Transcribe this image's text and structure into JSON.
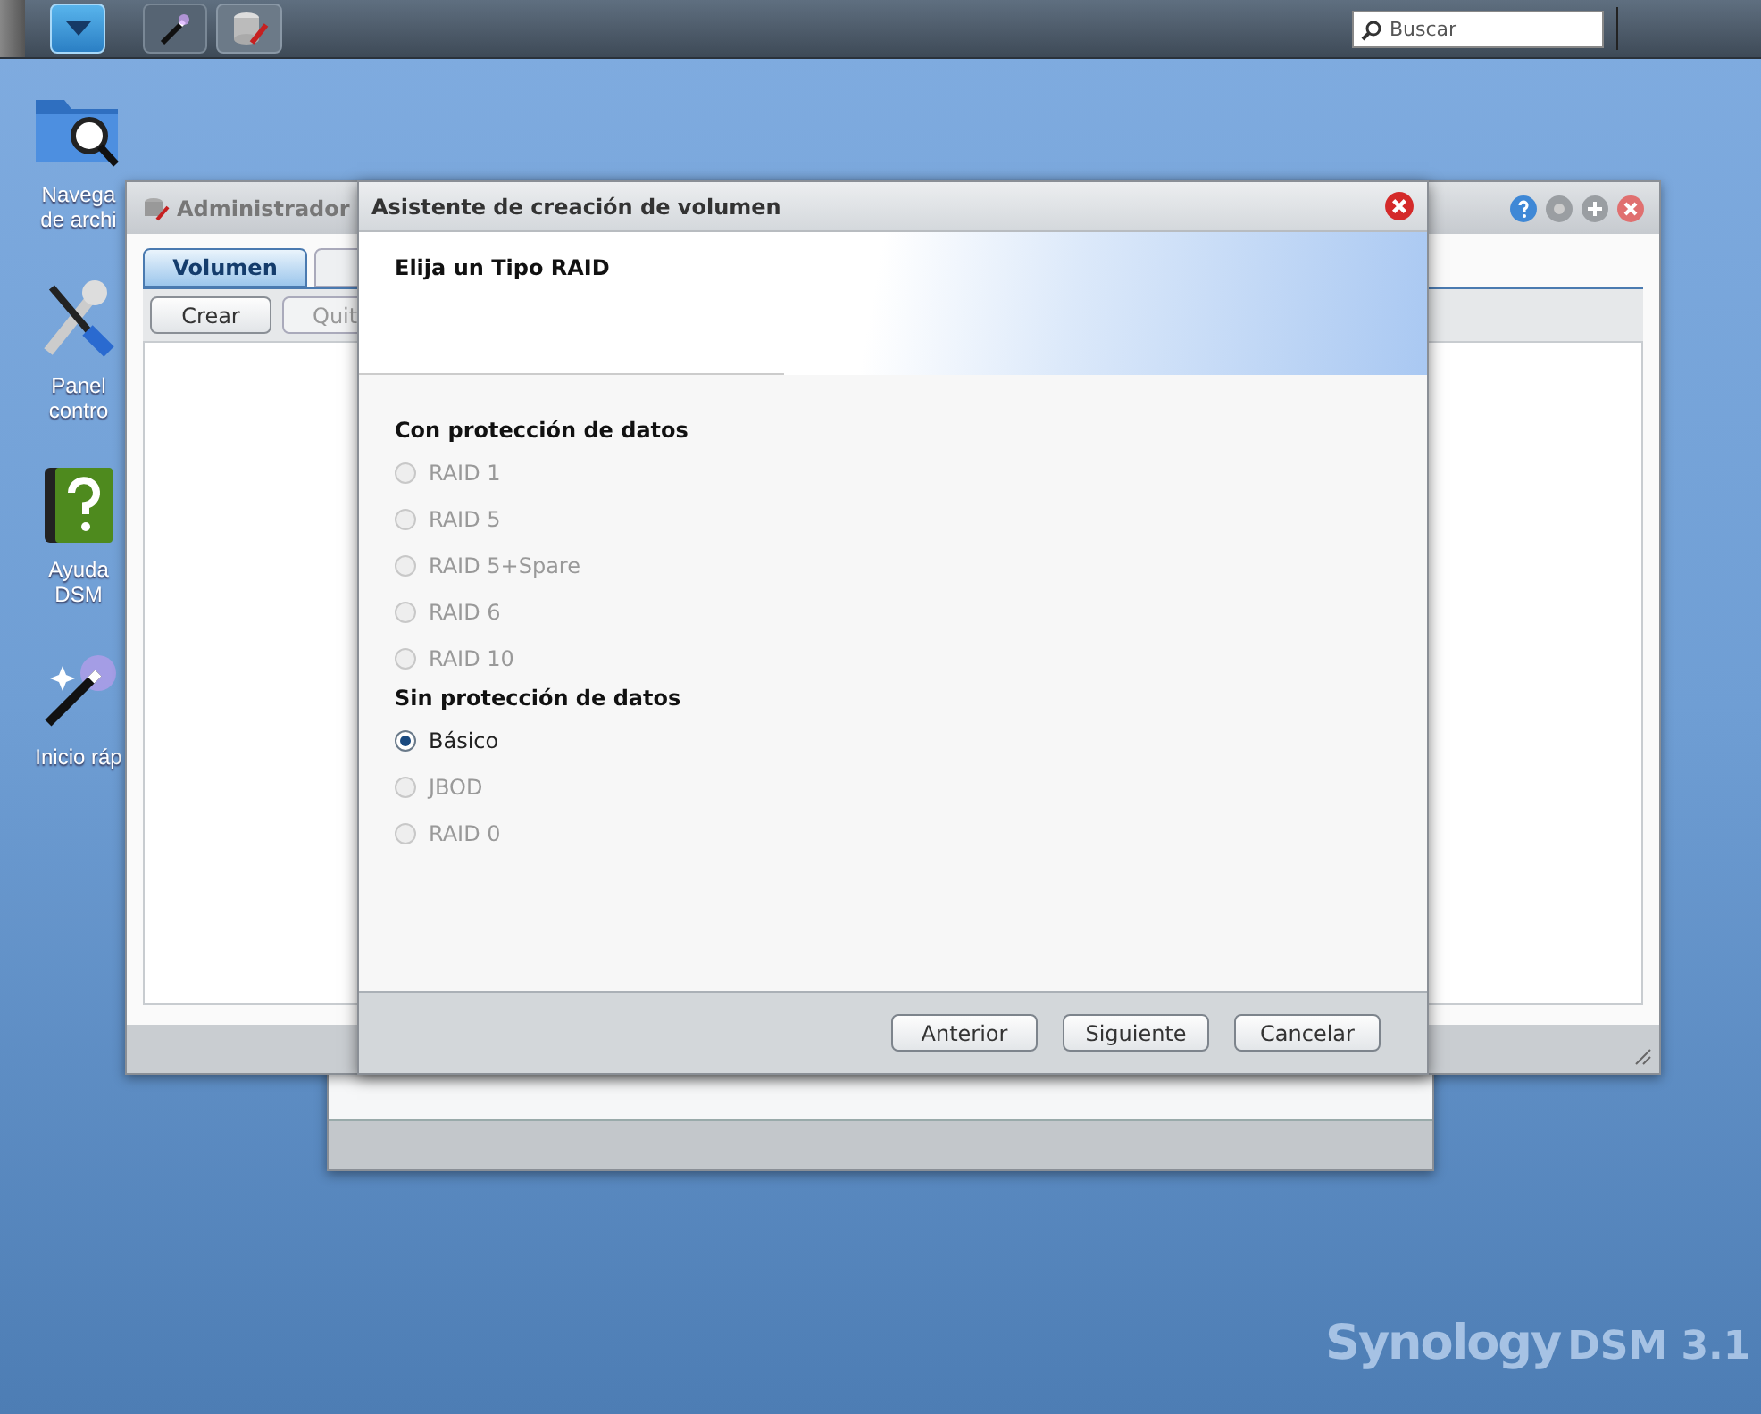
{
  "taskbar": {
    "search": {
      "placeholder": "Buscar"
    }
  },
  "desktop_icons": [
    {
      "kind": "folder",
      "lines": [
        "Navega",
        "de archi"
      ]
    },
    {
      "kind": "tools",
      "lines": [
        "Panel",
        "contro"
      ]
    },
    {
      "kind": "help",
      "lines": [
        "Ayuda",
        "DSM"
      ]
    },
    {
      "kind": "wand",
      "lines": [
        "Inicio ráp"
      ]
    }
  ],
  "back_window": {
    "title": "Administrador",
    "tabs": [
      {
        "label": "Volumen",
        "selected": true
      },
      {
        "selected": false
      }
    ],
    "buttons": [
      "Crear",
      "Quit"
    ]
  },
  "dialog": {
    "title": "Asistente de creación de volumen",
    "heading": "Elija un Tipo RAID",
    "groups": [
      {
        "title": "Con protección de datos",
        "options": [
          {
            "label": "RAID 1",
            "selected": false,
            "disabled": true
          },
          {
            "label": "RAID 5",
            "selected": false,
            "disabled": true
          },
          {
            "label": "RAID 5+Spare",
            "selected": false,
            "disabled": true
          },
          {
            "label": "RAID 6",
            "selected": false,
            "disabled": true
          },
          {
            "label": "RAID 10",
            "selected": false,
            "disabled": true
          }
        ]
      },
      {
        "title": "Sin protección de datos",
        "options": [
          {
            "label": "Básico",
            "selected": true,
            "disabled": false
          },
          {
            "label": "JBOD",
            "selected": false,
            "disabled": true
          },
          {
            "label": "RAID 0",
            "selected": false,
            "disabled": true
          }
        ]
      }
    ],
    "buttons": [
      "Anterior",
      "Siguiente",
      "Cancelar"
    ]
  },
  "brand": {
    "name": "Synology",
    "version": "DSM 3.1"
  }
}
